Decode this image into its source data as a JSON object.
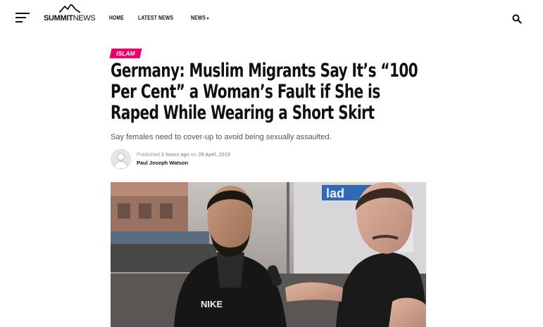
{
  "header": {
    "logo": {
      "summit": "SUMMIT",
      "news": "NEWS"
    },
    "nav": [
      {
        "label": "HOME"
      },
      {
        "label": "LATEST NEWS"
      },
      {
        "label": "NEWS"
      }
    ]
  },
  "article": {
    "category": "ISLAM",
    "title": "Germany: Muslim Migrants Say It’s “100 Per Cent” a Woman’s Fault if She is Raped While Wearing a Short Skirt",
    "subtitle": "Say females need to cover-up to avoid being sexually assaulted.",
    "byline": {
      "published_label": "Published",
      "time_ago": "2 hours ago",
      "on_label": "on",
      "date": "28 April, 2019",
      "author": "Paul Joseph Watson"
    }
  },
  "colors": {
    "accent": "#e5006a",
    "text": "#111111",
    "muted": "#999999"
  },
  "icons": [
    "menu-icon",
    "mountain-logo-icon",
    "search-icon",
    "avatar-placeholder-icon"
  ]
}
